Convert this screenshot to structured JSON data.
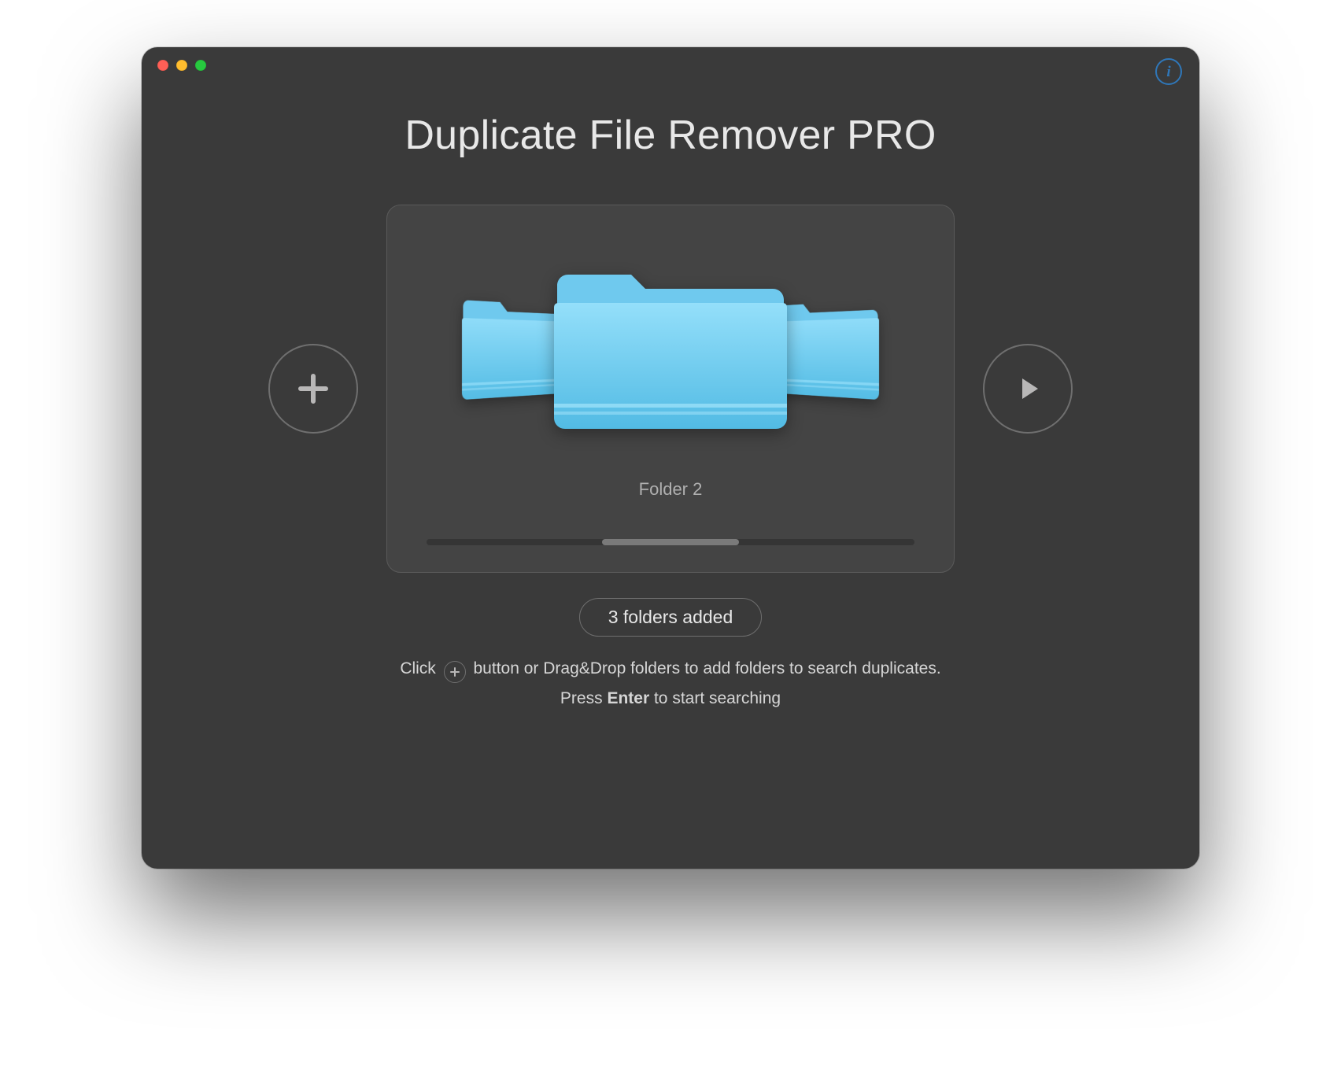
{
  "app": {
    "title": "Duplicate File Remover PRO"
  },
  "panel": {
    "selected_folder_label": "Folder 2",
    "folder_count": 3
  },
  "status": {
    "pill_text": "3 folders added"
  },
  "help": {
    "line1_pre": "Click ",
    "line1_post": " button or Drag&Drop folders to add folders to search duplicates.",
    "line2_pre": "Press ",
    "line2_key": "Enter",
    "line2_post": " to start searching"
  },
  "icons": {
    "info": "i",
    "add": "plus-icon",
    "start": "play-icon",
    "close": "close-icon",
    "minimize": "minimize-icon",
    "zoom": "zoom-icon",
    "folder": "folder-icon"
  },
  "colors": {
    "folder_light": "#8fdcf9",
    "folder_main": "#6ccff3",
    "folder_dark": "#55bde5",
    "info_blue": "#2f77b9"
  }
}
